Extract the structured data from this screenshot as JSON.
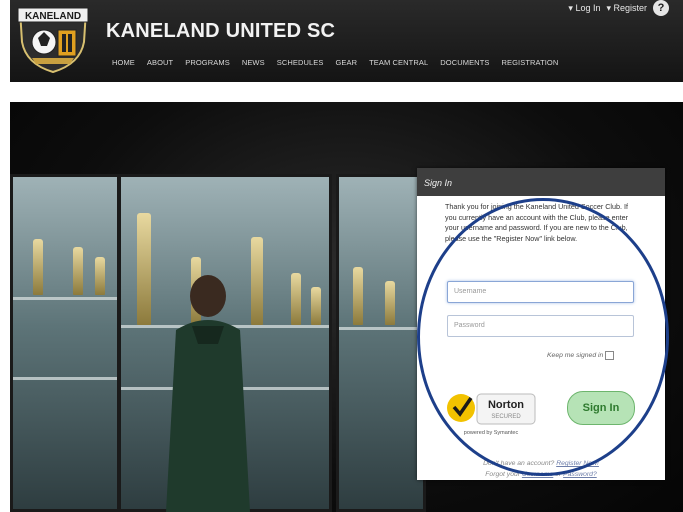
{
  "header": {
    "logo_text": "KANELAND",
    "title": "KANELAND UNITED SC",
    "top_links": {
      "login": "▾ Log In",
      "register": "▾ Register",
      "help": "?"
    }
  },
  "nav": {
    "items": [
      "HOME",
      "ABOUT",
      "PROGRAMS",
      "NEWS",
      "SCHEDULES",
      "GEAR",
      "TEAM CENTRAL",
      "DOCUMENTS",
      "REGISTRATION"
    ]
  },
  "signin": {
    "header": "Sign In",
    "intro": "Thank you for joining the Kaneland United Soccer Club. If you currently have an account with the Club, please enter your username and password. If you are new to the Club, please use the \"Register Now\" link below.",
    "username_placeholder": "Username",
    "password_placeholder": "Password",
    "keep_signed_in": "Keep me signed in",
    "button": "Sign In",
    "norton": {
      "brand": "Norton",
      "sub": "SECURED",
      "powered": "powered by Symantec"
    },
    "footer_line1_prefix": "Don't have an account?",
    "footer_register": "Register Now!",
    "footer_line2_prefix": "Forgot your",
    "footer_username": "Username",
    "footer_or": "or",
    "footer_password": "Password?"
  },
  "colors": {
    "header_bg": "#1c1c1c",
    "signin_header_bg": "#3e3e3e",
    "signin_button_bg": "#b6e3b6",
    "annotation_circle": "#1d3f8a",
    "norton_yellow": "#f2c200"
  }
}
